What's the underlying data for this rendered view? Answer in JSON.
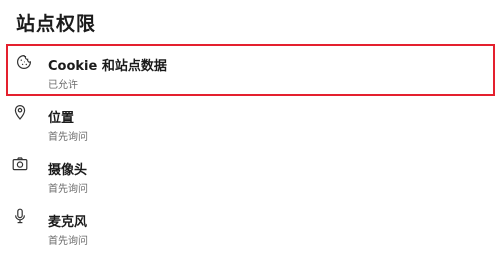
{
  "page": {
    "title": "站点权限"
  },
  "permissions": [
    {
      "icon": "cookie-icon",
      "label": "Cookie 和站点数据",
      "status": "已允许",
      "highlighted": true,
      "highlight_color": "#e4202e"
    },
    {
      "icon": "location-pin-icon",
      "label": "位置",
      "status": "首先询问"
    },
    {
      "icon": "camera-icon",
      "label": "摄像头",
      "status": "首先询问"
    },
    {
      "icon": "microphone-icon",
      "label": "麦克风",
      "status": "首先询问"
    }
  ]
}
